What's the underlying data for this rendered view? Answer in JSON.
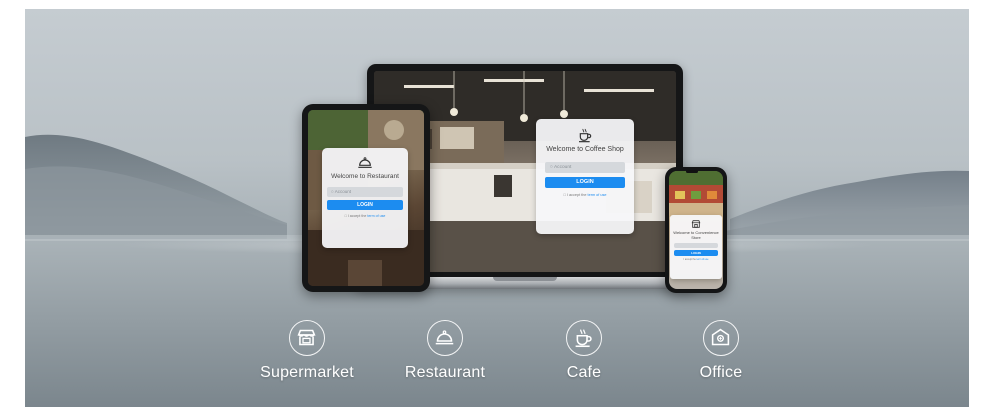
{
  "colors": {
    "accent": "#1c8cf0",
    "card_background": "#f6f7f9",
    "label_text": "#ffffff"
  },
  "devices": {
    "tablet": {
      "login_card": {
        "icon": "cloche-icon",
        "welcome": "Welcome to Restaurant",
        "username_placeholder": "Account",
        "login_label": "LOGIN",
        "terms_prefix": "I accept the",
        "terms_link": "term of use"
      }
    },
    "laptop": {
      "login_card": {
        "icon": "coffee-cup-icon",
        "welcome": "Welcome to Coffee Shop",
        "username_placeholder": "Account",
        "login_label": "LOGIN",
        "terms_prefix": "I accept the",
        "terms_link": "term of use"
      }
    },
    "phone": {
      "login_card": {
        "icon": "storefront-icon",
        "welcome": "Welcome to Convenience Store",
        "login_label": "LOGIN",
        "terms_prefix": "I accept the",
        "terms_link": "term of use"
      }
    }
  },
  "categories": [
    {
      "icon": "storefront-icon",
      "label": "Supermarket"
    },
    {
      "icon": "cloche-icon",
      "label": "Restaurant"
    },
    {
      "icon": "coffee-cup-icon",
      "label": "Cafe"
    },
    {
      "icon": "office-building-icon",
      "label": "Office"
    }
  ]
}
